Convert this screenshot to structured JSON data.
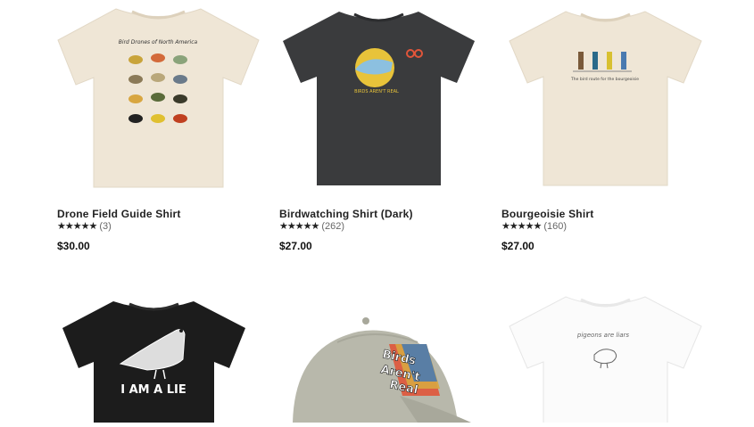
{
  "products": [
    {
      "name": "Drone Field Guide Shirt",
      "stars": "★★★★★",
      "reviews": "(3)",
      "price": "$30.00",
      "print": {
        "title": "Bird Drones of North America"
      }
    },
    {
      "name": "Birdwatching Shirt (Dark)",
      "stars": "★★★★★",
      "reviews": "(262)",
      "price": "$27.00",
      "print": {
        "text": "BIRDS AREN'T REAL"
      }
    },
    {
      "name": "Bourgeoisie Shirt",
      "stars": "★★★★★",
      "reviews": "(160)",
      "price": "$27.00",
      "print": {
        "text": "The bird route for the bourgeoisie"
      }
    },
    {
      "name": "",
      "stars": "",
      "reviews": "",
      "price": "",
      "print": {
        "text": "I AM A LIE"
      }
    },
    {
      "name": "",
      "stars": "",
      "reviews": "",
      "price": "",
      "print": {
        "line1": "Birds",
        "line2": "Aren't",
        "line3": "Real"
      }
    },
    {
      "name": "",
      "stars": "",
      "reviews": "",
      "price": "",
      "print": {
        "text": "pigeons are liars"
      }
    }
  ],
  "colors": {
    "cream_shirt": "#efe6d6",
    "dark_shirt": "#3a3b3d",
    "black_shirt": "#1c1c1c",
    "white_shirt": "#fbfbfb",
    "cap": "#b8b8ab"
  }
}
